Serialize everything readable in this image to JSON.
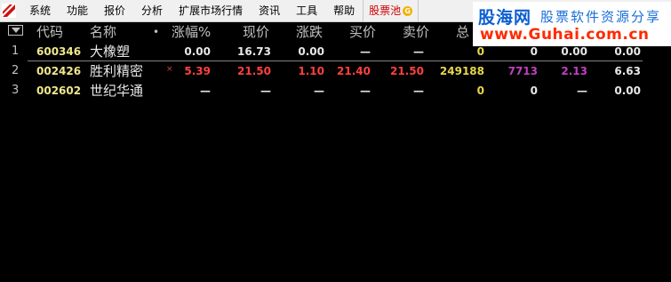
{
  "menu": {
    "items": [
      "系统",
      "功能",
      "报价",
      "分析",
      "扩展市场行情",
      "资讯",
      "工具",
      "帮助"
    ],
    "pool_label": "股票池",
    "pool_badge": "G"
  },
  "watermark": {
    "brand": "股海网",
    "slogan": "股票软件资源分享",
    "url": "www.Guhai.com.cn"
  },
  "header": {
    "code": "代码",
    "name": "名称",
    "dot": "•",
    "change_pct": "涨幅%",
    "price": "现价",
    "change": "涨跌",
    "bid": "买价",
    "ask": "卖价",
    "volume": "总"
  },
  "rows": [
    {
      "index": "1",
      "code": "600346",
      "name": "大橡塑",
      "flag": "",
      "change_pct": "0.00",
      "price": "16.73",
      "change": "0.00",
      "bid": "—",
      "ask": "—",
      "volume": "0",
      "c7": "0",
      "c8": "0.00",
      "c9": "0.00"
    },
    {
      "index": "2",
      "code": "002426",
      "name": "胜利精密",
      "flag": "×",
      "change_pct": "5.39",
      "price": "21.50",
      "change": "1.10",
      "bid": "21.40",
      "ask": "21.50",
      "volume": "249188",
      "c7": "7713",
      "c8": "2.13",
      "c9": "6.63"
    },
    {
      "index": "3",
      "code": "002602",
      "name": "世纪华通",
      "flag": "",
      "change_pct": "—",
      "price": "—",
      "change": "—",
      "bid": "—",
      "ask": "—",
      "volume": "0",
      "c7": "0",
      "c8": "—",
      "c9": "0.00"
    }
  ]
}
